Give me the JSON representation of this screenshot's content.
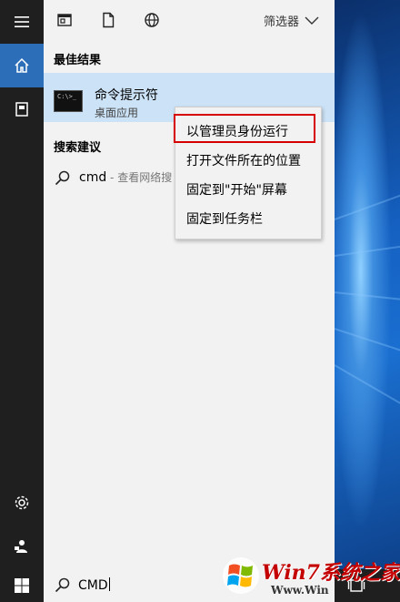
{
  "top_filters": {
    "filter_label": "筛选器"
  },
  "best_match": {
    "heading": "最佳结果",
    "name": "命令提示符",
    "subtitle": "桌面应用"
  },
  "suggestions": {
    "heading": "搜索建议",
    "item_text": "cmd",
    "item_sub": " - 查看网络搜"
  },
  "context_menu": {
    "items": [
      "以管理员身份运行",
      "打开文件所在的位置",
      "固定到\"开始\"屏幕",
      "固定到任务栏"
    ]
  },
  "search": {
    "value": "CMD"
  },
  "watermark": {
    "logo_text": "Win7系统之家",
    "url": "Www.Win"
  },
  "colors": {
    "rail": "#1f1f1f",
    "panel": "#f2f2f2",
    "selected": "#cce2f6",
    "highlight_box": "#d60000",
    "accent": "#0078d7"
  }
}
